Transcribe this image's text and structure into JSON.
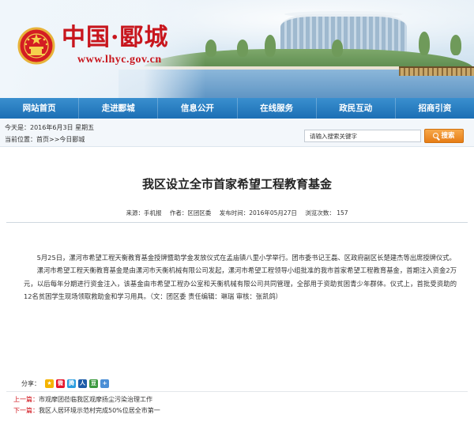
{
  "site": {
    "title": "中国·郾城",
    "url": "www.lhyc.gov.cn"
  },
  "nav": {
    "items": [
      "网站首页",
      "走进郾城",
      "信息公开",
      "在线服务",
      "政民互动",
      "招商引资"
    ]
  },
  "infobar": {
    "date_text": "今天是：2016年6月3日 星期五",
    "location_label": "当前位置：",
    "crumb_home": "首页",
    "crumb_sep": ">>",
    "crumb_current": "今日郾城"
  },
  "search": {
    "placeholder": "请输入搜索关键字",
    "button_label": "搜索"
  },
  "article": {
    "title": "我区设立全市首家希望工程教育基金",
    "source": "来源：手机报",
    "author": "作者：区团区委",
    "published": "发布时间：2016年05月27日",
    "views": "浏览次数： 157",
    "paragraphs": [
      "5月25日，漯河市希望工程天衡教育基金授牌暨助学金发放仪式在孟庙镇八里小学举行。团市委书记王磊、区政府副区长楚建杰等出席授牌仪式。",
      "漯河市希望工程天衡教育基金是由漯河市天衡机械有限公司发起，漯河市希望工程领导小组批准的我市首家希望工程教育基金，首期注入资金2万元，以后每年分期进行资金注入，该基金由市希望工程办公室和天衡机械有限公司共同管理，全部用于资助贫困青少年群体。仪式上，首批受资助的12名贫困学生现场领取救助金和学习用具。（文：团区委 责任编辑：琳瑞 审核：张凯鸽）"
    ]
  },
  "share": {
    "label": "分享：",
    "icons": [
      {
        "name": "qzone-icon",
        "glyph": "★",
        "color": "#f5b400"
      },
      {
        "name": "weibo-icon",
        "glyph": "微",
        "color": "#e6162d"
      },
      {
        "name": "tencent-weibo-icon",
        "glyph": "腾",
        "color": "#2a9de0"
      },
      {
        "name": "renren-icon",
        "glyph": "人",
        "color": "#1c5ba8"
      },
      {
        "name": "douban-icon",
        "glyph": "豆",
        "color": "#3c9a3f"
      },
      {
        "name": "more-icon",
        "glyph": "+",
        "color": "#4b8fd6"
      }
    ]
  },
  "pager": {
    "prev_label": "上一篇：",
    "prev_title": "市观摩团莅临我区观摩扬尘污染治理工作",
    "next_label": "下一篇：",
    "next_title": "我区人居环境示范村完成50%位居全市第一"
  }
}
